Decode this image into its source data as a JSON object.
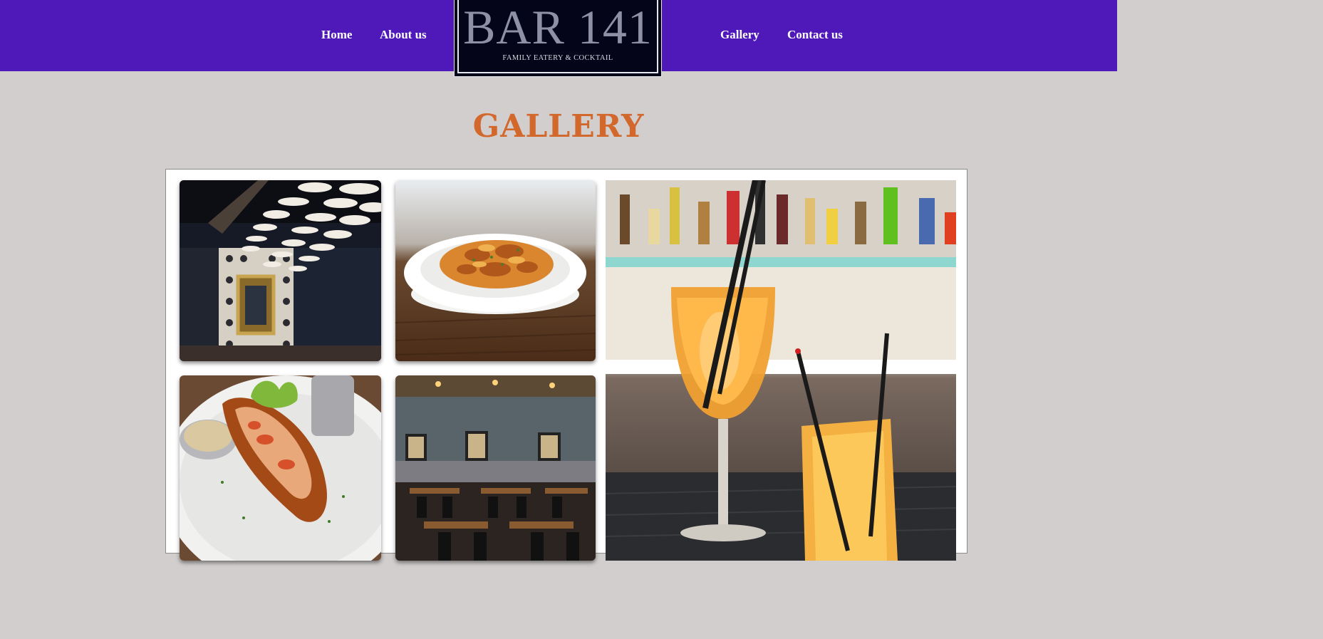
{
  "nav": {
    "left": [
      {
        "label": "Home"
      },
      {
        "label": "About us"
      }
    ],
    "right": [
      {
        "label": "Gallery"
      },
      {
        "label": "Contact us"
      }
    ]
  },
  "logo": {
    "title": "BAR 141",
    "subtitle": "FAMILY EATERY & COCKTAIL"
  },
  "page": {
    "heading": "GALLERY"
  },
  "gallery": {
    "photos": [
      {
        "subject": "dining-room-interior"
      },
      {
        "subject": "pasta-dish"
      },
      {
        "subject": "lobster-roll"
      },
      {
        "subject": "dining-tables"
      },
      {
        "subject": "cocktails-at-bar"
      }
    ]
  },
  "colors": {
    "header_bg": "#4f18b8",
    "page_bg": "#d1cecd",
    "heading": "#d2682c",
    "logo_bg": "#05051a"
  }
}
